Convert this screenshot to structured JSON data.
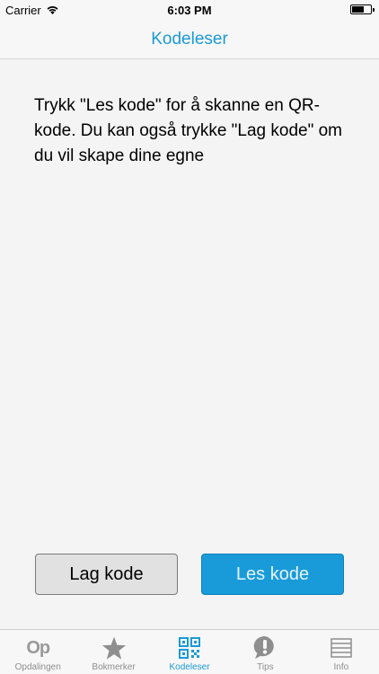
{
  "status_bar": {
    "carrier": "Carrier",
    "time": "6:03 PM"
  },
  "nav": {
    "title": "Kodeleser"
  },
  "main": {
    "instruction": "Trykk \"Les kode\" for å skanne en QR-kode. Du kan også trykke \"Lag kode\" om du vil skape dine egne"
  },
  "buttons": {
    "lag_kode": "Lag kode",
    "les_kode": "Les kode"
  },
  "tabs": [
    {
      "label": "Opdalingen",
      "icon": "op-logo-icon",
      "logo_text": "Op"
    },
    {
      "label": "Bokmerker",
      "icon": "star-icon"
    },
    {
      "label": "Kodeleser",
      "icon": "qr-code-icon",
      "active": true
    },
    {
      "label": "Tips",
      "icon": "exclamation-bubble-icon"
    },
    {
      "label": "Info",
      "icon": "list-icon"
    }
  ],
  "colors": {
    "accent": "#1a9ad6",
    "primary_button": "#199bd9",
    "secondary_button": "#e1e1e1",
    "background": "#f4f4f4",
    "inactive_tab": "#8e8e8e"
  }
}
